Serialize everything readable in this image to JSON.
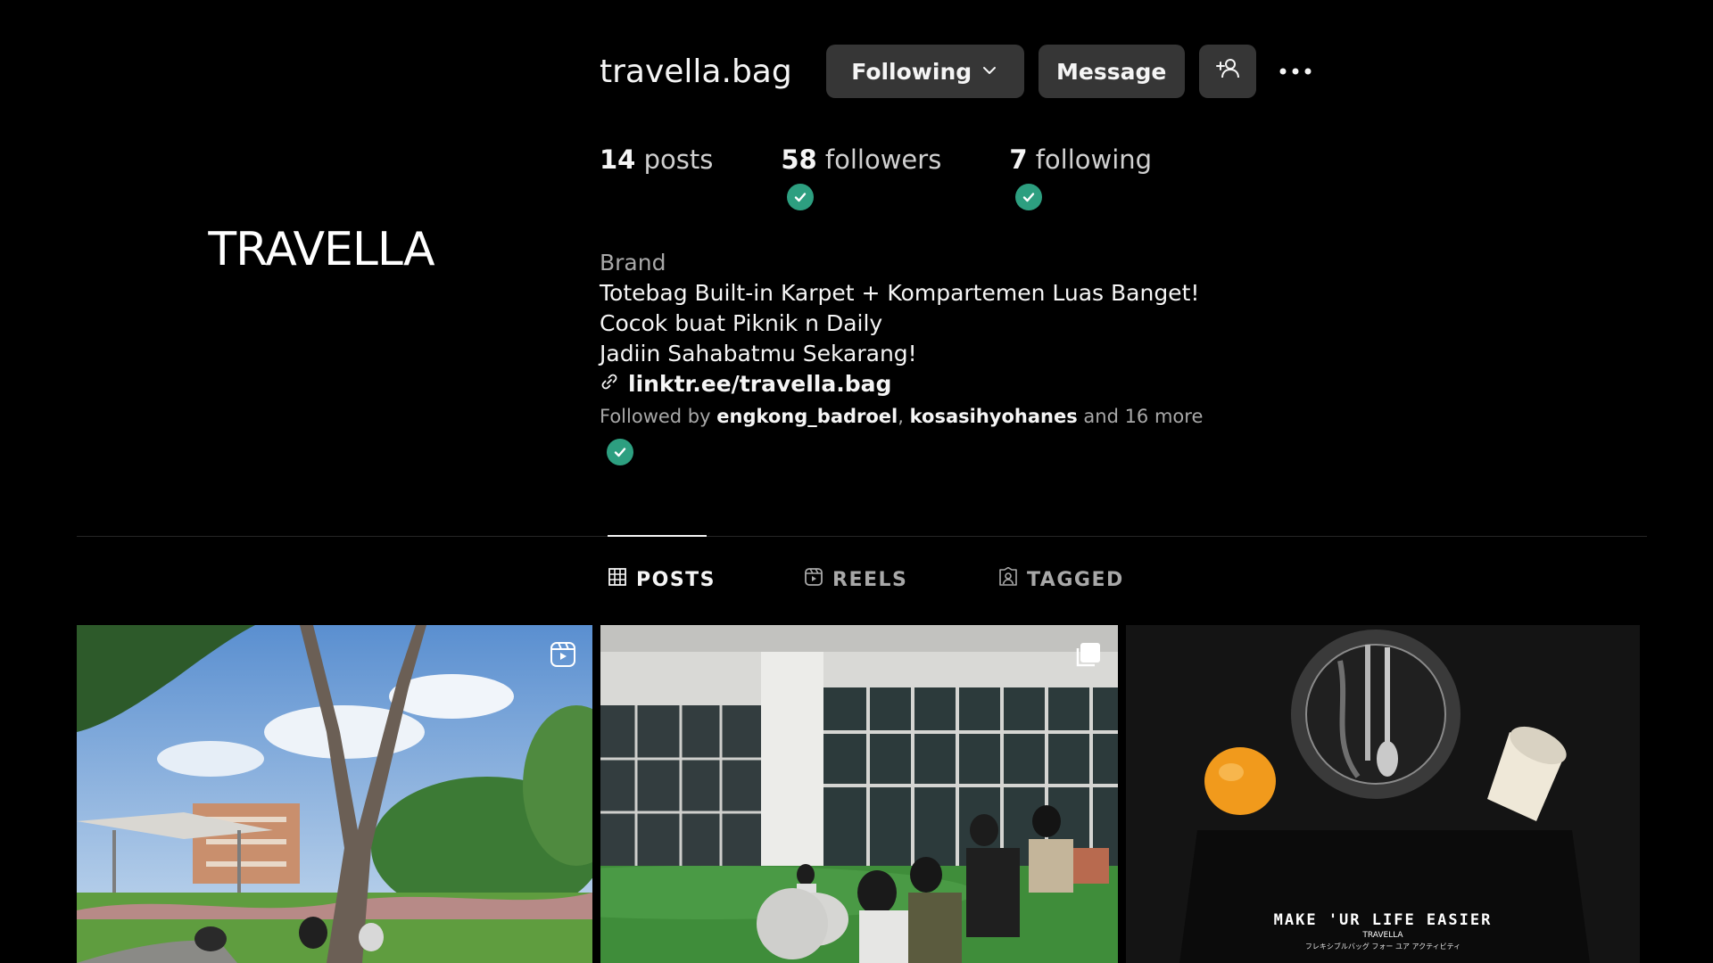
{
  "profile": {
    "avatar_logo_text": "TRAVELLA",
    "username": "travella.bag",
    "buttons": {
      "following_label": "Following",
      "message_label": "Message",
      "suggest_icon": "add-person-icon",
      "more_icon": "more-options-icon"
    },
    "stats": {
      "posts_count": "14",
      "posts_label": "posts",
      "followers_count": "58",
      "followers_label": "followers",
      "following_count": "7",
      "following_label": "following"
    },
    "bio": {
      "category": "Brand",
      "lines": [
        "Totebag Built-in Karpet + Kompartemen Luas Banget!",
        "Cocok buat Piknik n Daily",
        "Jadiin Sahabatmu Sekarang!"
      ],
      "link": "linktr.ee/travella.bag",
      "followed_by_prefix": "Followed by",
      "followed_by_user1": "engkong_badroel",
      "followed_by_separator": ",",
      "followed_by_user2": "kosasihyohanes",
      "followed_by_suffix": "and 16 more"
    }
  },
  "tabs": [
    {
      "label": "POSTS",
      "icon": "grid-icon",
      "active": true
    },
    {
      "label": "REELS",
      "icon": "reels-icon",
      "active": false
    },
    {
      "label": "TAGGED",
      "icon": "tagged-icon",
      "active": false
    }
  ],
  "posts": [
    {
      "type": "reel",
      "badge_icon": "reel-icon"
    },
    {
      "type": "carousel",
      "badge_icon": "carousel-icon"
    },
    {
      "type": "image",
      "overlay_text": "MAKE 'UR LIFE EASIER",
      "overlay_logo": "TRAVELLA",
      "overlay_subtext": "フレキシブルバッグ フォー ユア アクティビティ"
    }
  ],
  "colors": {
    "background": "#000000",
    "button_bg": "#363636",
    "verified_badge": "#2d9f80",
    "muted_text": "#a8a8a8",
    "divider": "#262626"
  }
}
